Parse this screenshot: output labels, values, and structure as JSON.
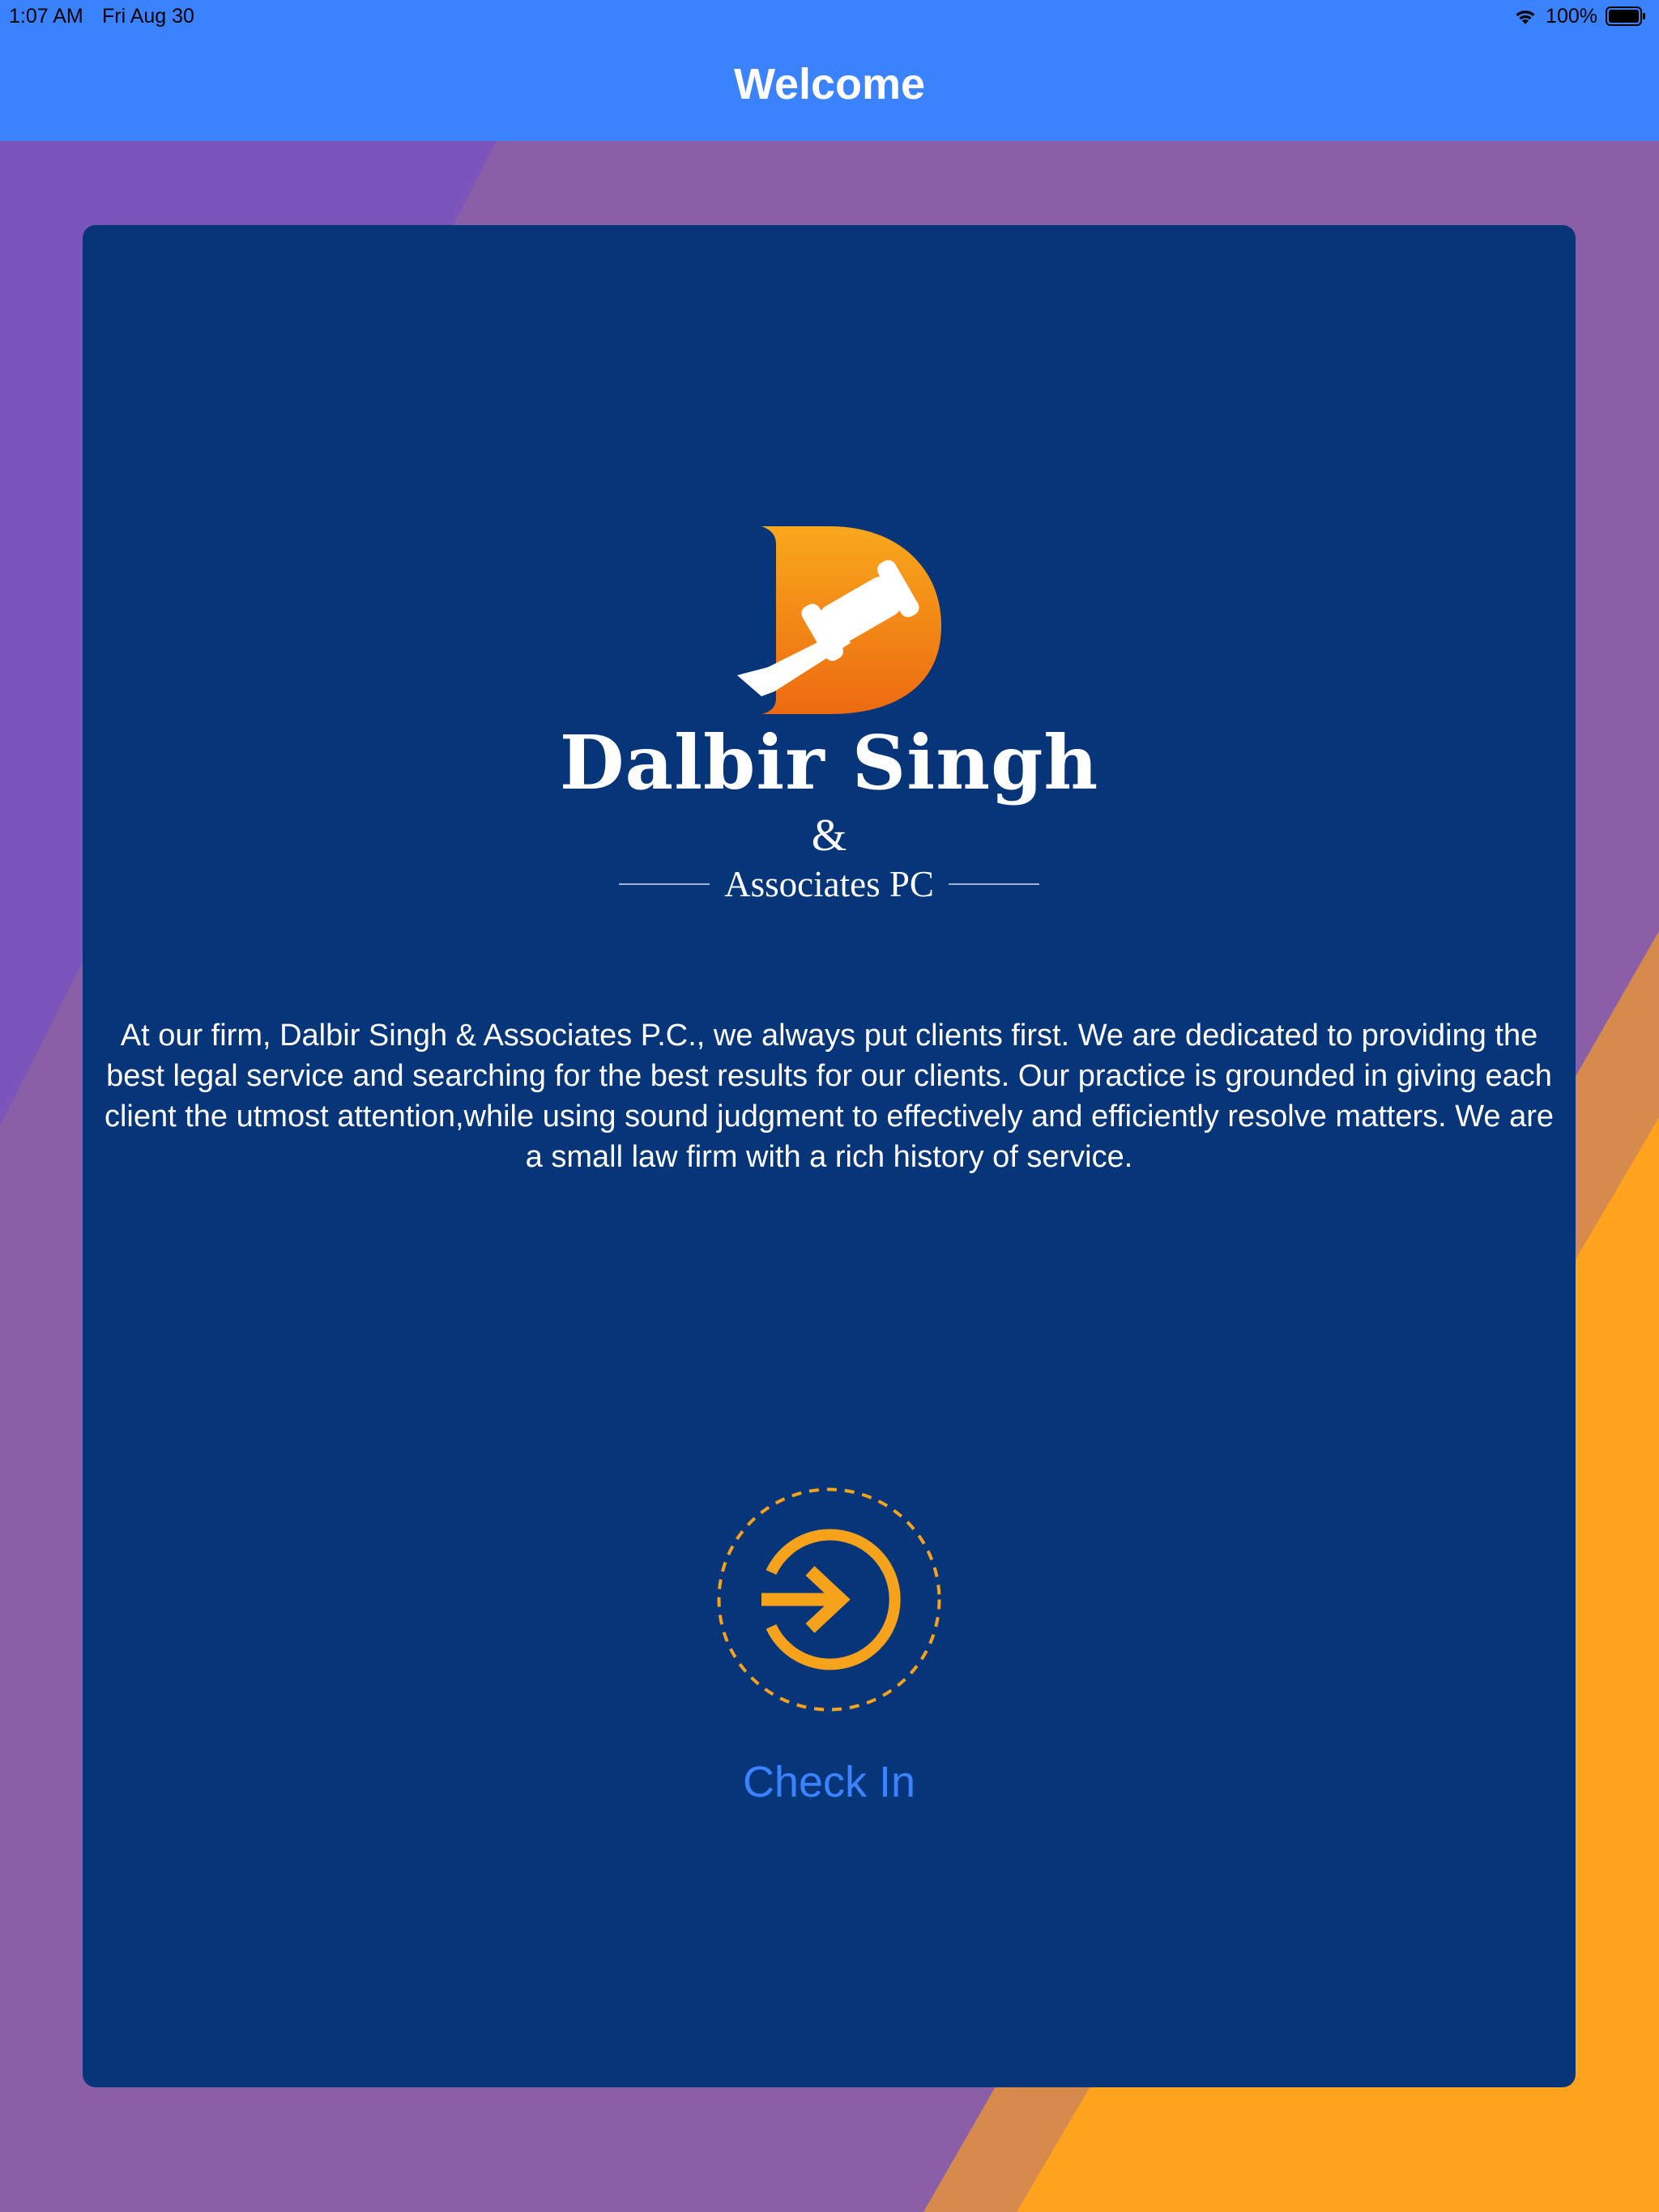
{
  "status_bar": {
    "time": "1:07 AM",
    "date": "Fri Aug 30",
    "battery": "100%",
    "wifi_icon": "wifi-icon",
    "battery_icon": "battery-icon"
  },
  "nav": {
    "title": "Welcome"
  },
  "logo": {
    "icon": "gavel-d-logo",
    "name": "Dalbir Singh",
    "ampersand": "&",
    "associates": "Associates PC"
  },
  "intro": "At our firm, Dalbir Singh & Associates P.C., we always put clients first. We are dedicated to providing the best legal service and searching for the best results for our clients. Our practice is grounded in giving each client the utmost attention,while using sound judgment to effectively and efficiently resolve matters. We are a small law firm with a rich history of service.",
  "check_in": {
    "label": "Check In",
    "icon": "sign-in-arrow-icon"
  },
  "colors": {
    "header": "#3b82ff",
    "card": "#07357a",
    "accent_orange": "#f7a21b",
    "link_blue": "#3b82ff",
    "background_purple": "#8a5fa8"
  }
}
